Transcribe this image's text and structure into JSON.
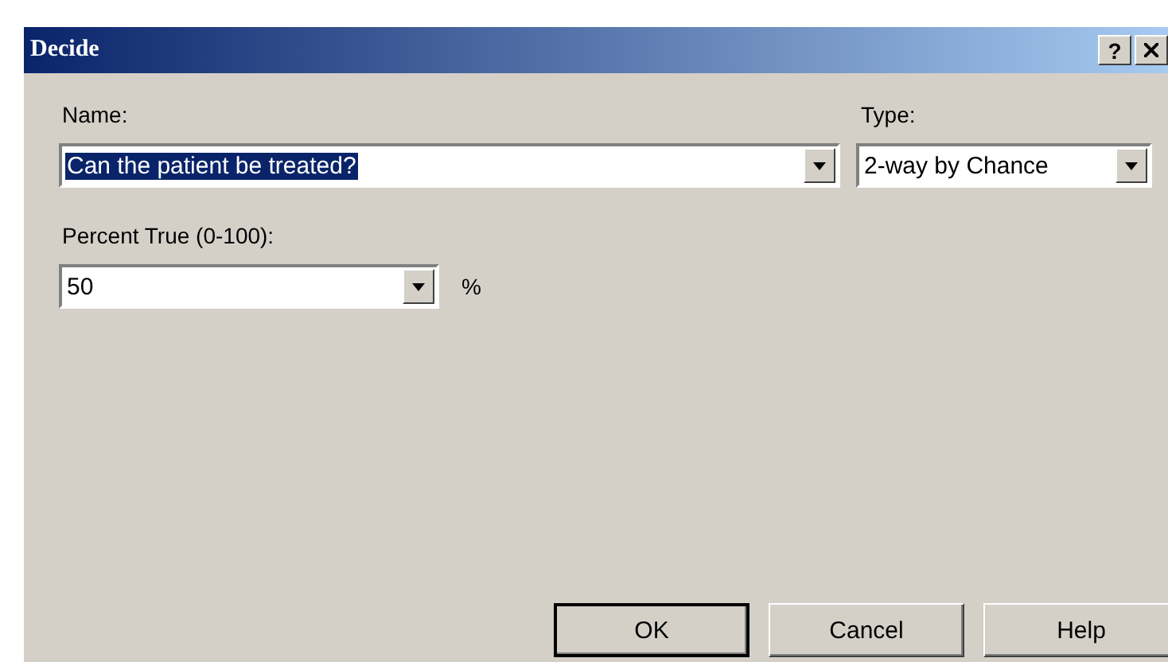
{
  "window": {
    "title": "Decide",
    "help_glyph": "?"
  },
  "name": {
    "label": "Name:",
    "value": "Can the patient be treated?",
    "text_selected": true
  },
  "type": {
    "label": "Type:",
    "value": "2-way by Chance"
  },
  "percent": {
    "label": "Percent True (0-100):",
    "value": "50",
    "unit": "%"
  },
  "buttons": [
    {
      "label": "OK",
      "default": true
    },
    {
      "label": "Cancel",
      "default": false
    },
    {
      "label": "Help",
      "default": false
    }
  ]
}
